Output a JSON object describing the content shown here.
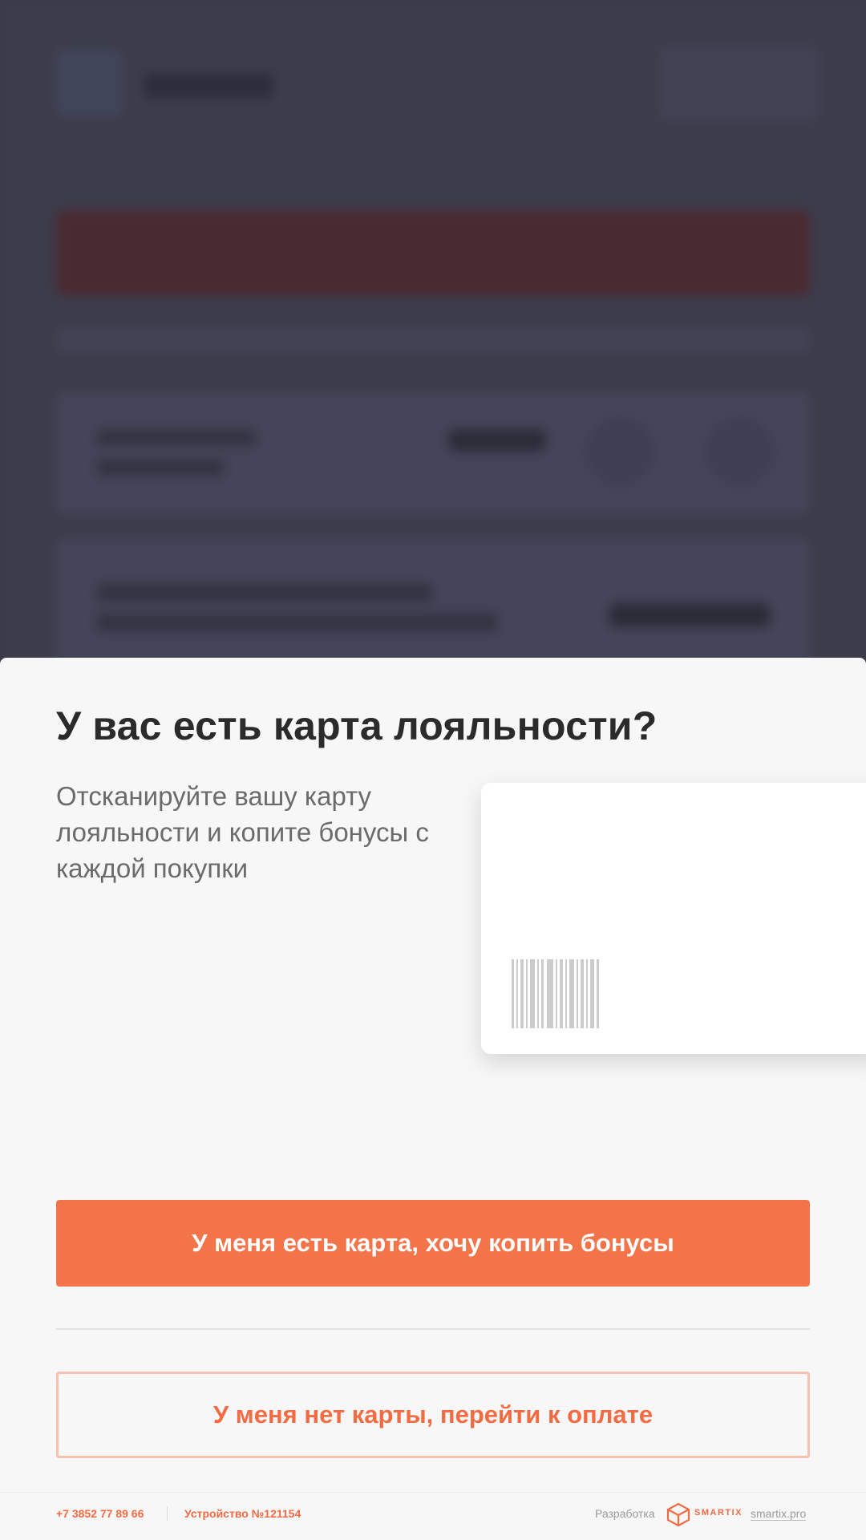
{
  "modal": {
    "title": "У вас есть карта лояльности?",
    "description": "Отсканируйте вашу карту лояльности и копите бонусы с каждой покупки",
    "card_illustration": "loyalty-card-with-barcode",
    "primary_button": "У меня есть карта, хочу копить бонусы",
    "secondary_button": "У меня нет карты, перейти к оплате"
  },
  "footer": {
    "phone": "+7 3852 77 89 66",
    "device": "Устройство №121154",
    "developer_label": "Разработка",
    "brand_name": "SMARTIX",
    "brand_link": "smartix.pro"
  },
  "colors": {
    "accent": "#f4744a",
    "accent_text": "#f26b43",
    "overlay": "#3c3c4b",
    "modal_bg": "#f7f7f7"
  }
}
